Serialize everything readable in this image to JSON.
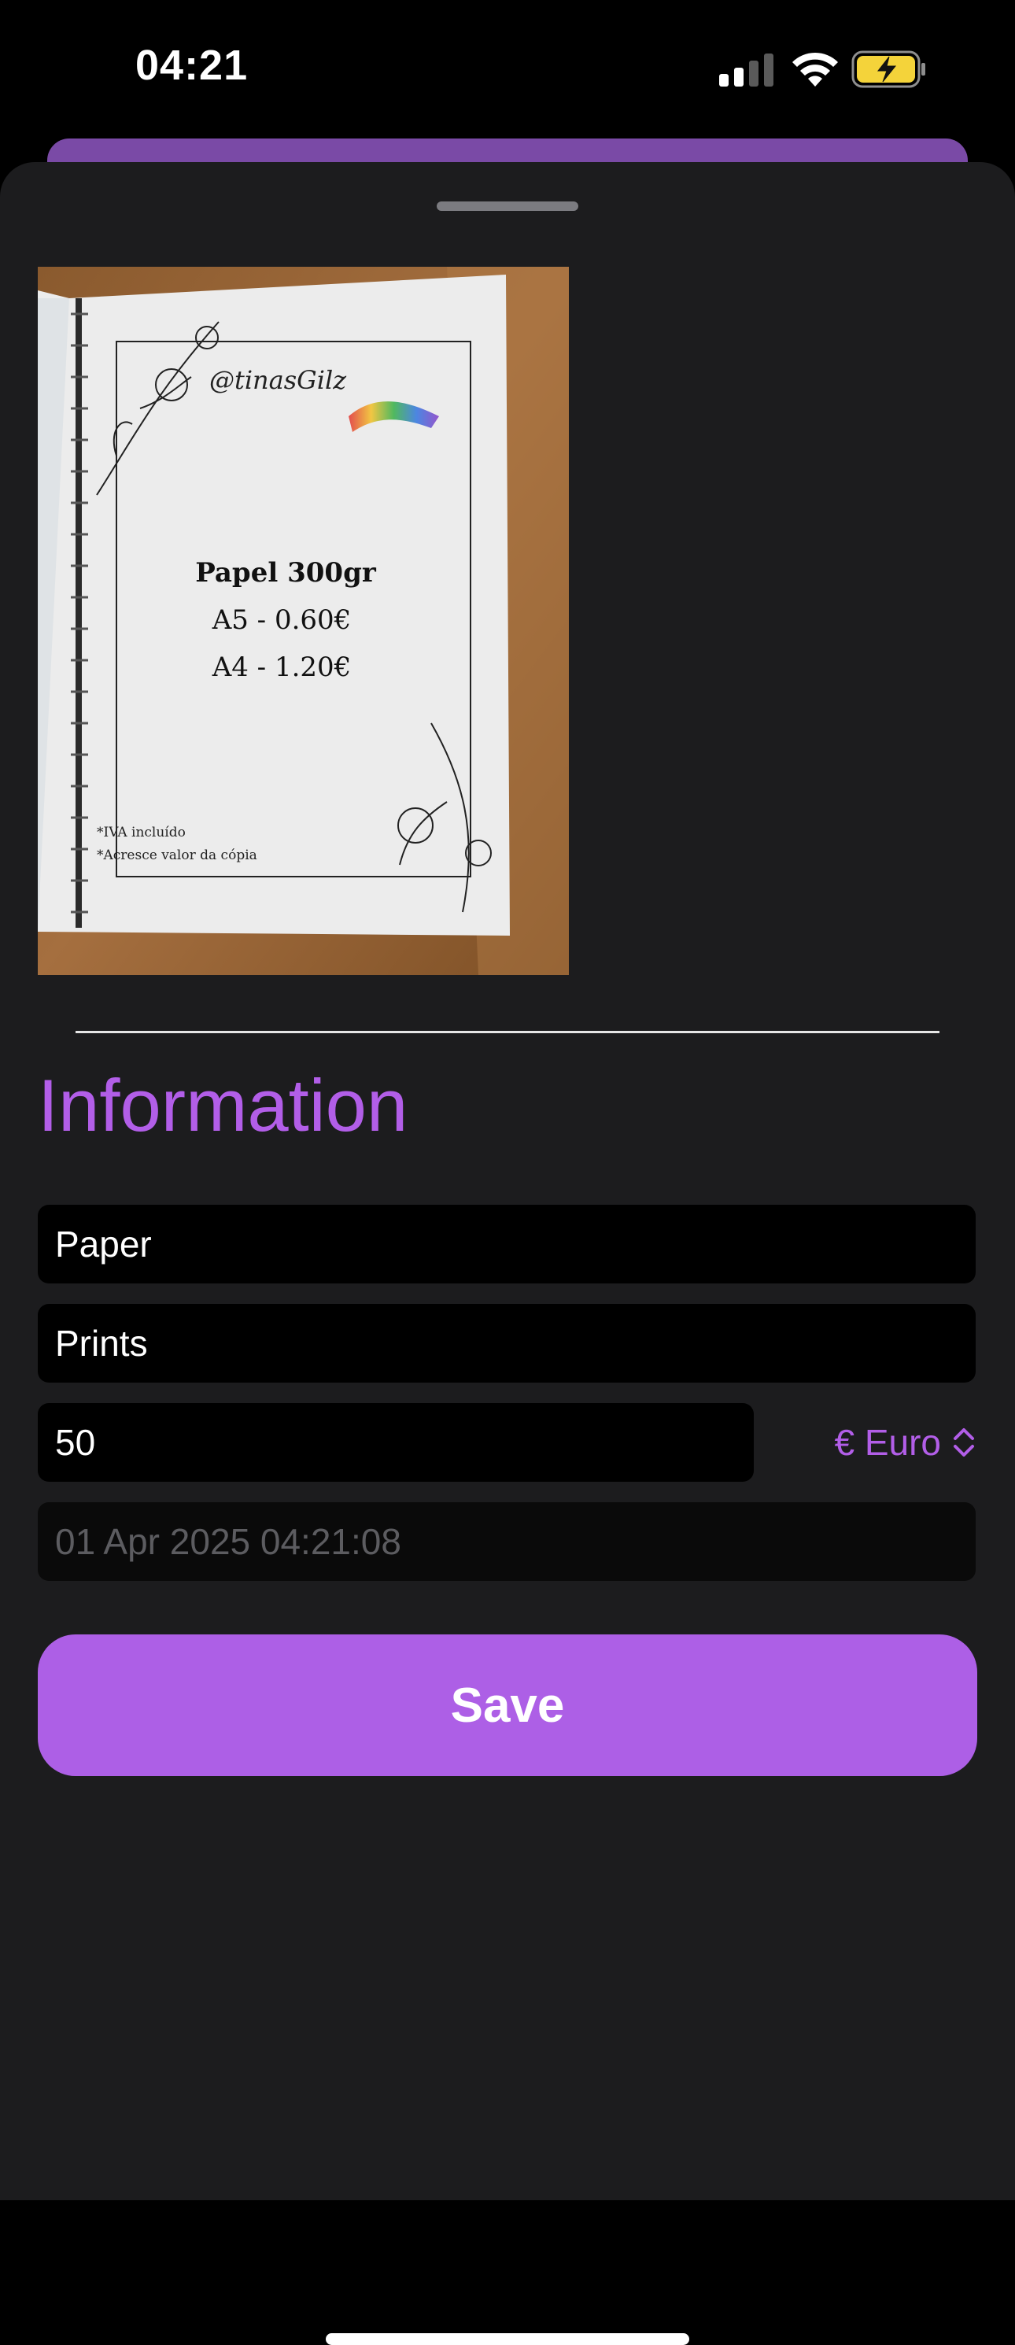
{
  "status_bar": {
    "time": "04:21",
    "icons": [
      "cellular-signal-icon",
      "wifi-icon",
      "battery-charging-icon"
    ]
  },
  "photo": {
    "alt_icon": "receipt-photo",
    "paper_text": {
      "signature": "@tinasGilz",
      "title": "Papel 300gr",
      "line1": "A5 - 0.60€",
      "line2": "A4 - 1.20€",
      "note1": "*IVA incluído",
      "note2": "*Acresce valor da cópia"
    }
  },
  "section": {
    "title": "Information"
  },
  "form": {
    "name_value": "Paper",
    "category_value": "Prints",
    "amount_value": "50",
    "currency_label": "€ Euro",
    "date_placeholder": "01 Apr 2025 04:21:08"
  },
  "actions": {
    "save_label": "Save"
  },
  "colors": {
    "accent": "#b25ee8",
    "button": "#ad5fe6",
    "sheet": "#1c1c1e",
    "field": "#000000"
  }
}
